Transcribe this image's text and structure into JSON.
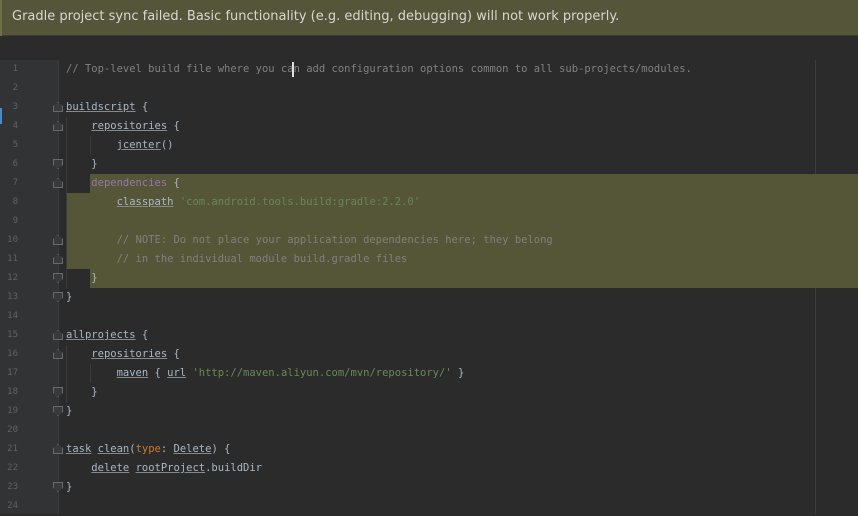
{
  "banner": {
    "message": "Gradle project sync failed. Basic functionality (e.g. editing, debugging) will not work properly."
  },
  "editor": {
    "lines": [
      {
        "n": "1",
        "segments": [
          {
            "t": "// Top-level build file where you can add configuration options common to all sub-projects/modules.",
            "c": "cmt"
          }
        ]
      },
      {
        "n": "2",
        "segments": []
      },
      {
        "n": "3",
        "segments": [
          {
            "t": "buildscript",
            "c": "meth"
          },
          {
            "t": " {",
            "c": "plain"
          }
        ]
      },
      {
        "n": "4",
        "segments": [
          {
            "t": "    ",
            "c": "plain"
          },
          {
            "t": "repositories",
            "c": "meth"
          },
          {
            "t": " {",
            "c": "plain"
          }
        ]
      },
      {
        "n": "5",
        "segments": [
          {
            "t": "        ",
            "c": "plain"
          },
          {
            "t": "jcenter",
            "c": "meth"
          },
          {
            "t": "()",
            "c": "plain"
          }
        ]
      },
      {
        "n": "6",
        "segments": [
          {
            "t": "    }",
            "c": "plain"
          }
        ]
      },
      {
        "n": "7",
        "segments": [
          {
            "t": "    ",
            "c": "plain"
          },
          {
            "t": "dependencies",
            "c": "tag"
          },
          {
            "t": " {",
            "c": "plain"
          }
        ]
      },
      {
        "n": "8",
        "segments": [
          {
            "t": "        ",
            "c": "plain"
          },
          {
            "t": "classpath",
            "c": "meth"
          },
          {
            "t": " ",
            "c": "plain"
          },
          {
            "t": "'com.android.tools.build:gradle:2.2.0'",
            "c": "str"
          }
        ]
      },
      {
        "n": "9",
        "segments": []
      },
      {
        "n": "10",
        "segments": [
          {
            "t": "        // NOTE: Do not place your application dependencies here; they belong",
            "c": "cmt"
          }
        ]
      },
      {
        "n": "11",
        "segments": [
          {
            "t": "        // in the individual module build.gradle files",
            "c": "cmt"
          }
        ]
      },
      {
        "n": "12",
        "segments": [
          {
            "t": "    }",
            "c": "plain"
          }
        ]
      },
      {
        "n": "13",
        "segments": [
          {
            "t": "}",
            "c": "plain"
          }
        ]
      },
      {
        "n": "14",
        "segments": []
      },
      {
        "n": "15",
        "segments": [
          {
            "t": "allprojects",
            "c": "meth"
          },
          {
            "t": " {",
            "c": "plain"
          }
        ]
      },
      {
        "n": "16",
        "segments": [
          {
            "t": "    ",
            "c": "plain"
          },
          {
            "t": "repositories",
            "c": "meth"
          },
          {
            "t": " {",
            "c": "plain"
          }
        ]
      },
      {
        "n": "17",
        "segments": [
          {
            "t": "        ",
            "c": "plain"
          },
          {
            "t": "maven",
            "c": "meth"
          },
          {
            "t": " { ",
            "c": "plain"
          },
          {
            "t": "url",
            "c": "meth"
          },
          {
            "t": " ",
            "c": "plain"
          },
          {
            "t": "'http://maven.aliyun.com/mvn/repository/'",
            "c": "str"
          },
          {
            "t": " }",
            "c": "plain"
          }
        ]
      },
      {
        "n": "18",
        "segments": [
          {
            "t": "    }",
            "c": "plain"
          }
        ]
      },
      {
        "n": "19",
        "segments": [
          {
            "t": "}",
            "c": "plain"
          }
        ]
      },
      {
        "n": "20",
        "segments": []
      },
      {
        "n": "21",
        "segments": [
          {
            "t": "task",
            "c": "meth"
          },
          {
            "t": " ",
            "c": "plain"
          },
          {
            "t": "clean",
            "c": "meth"
          },
          {
            "t": "(",
            "c": "plain"
          },
          {
            "t": "type",
            "c": "kw"
          },
          {
            "t": ": ",
            "c": "plain"
          },
          {
            "t": "Delete",
            "c": "meth"
          },
          {
            "t": ") {",
            "c": "plain"
          }
        ]
      },
      {
        "n": "22",
        "segments": [
          {
            "t": "    ",
            "c": "plain"
          },
          {
            "t": "delete",
            "c": "meth"
          },
          {
            "t": " ",
            "c": "plain"
          },
          {
            "t": "rootProject",
            "c": "meth"
          },
          {
            "t": ".buildDir",
            "c": "plain"
          }
        ]
      },
      {
        "n": "23",
        "segments": [
          {
            "t": "}",
            "c": "plain"
          }
        ]
      },
      {
        "n": "24",
        "segments": []
      }
    ]
  },
  "colors": {
    "banner_bg": "#55553a",
    "editor_bg": "#2b2b2b",
    "highlight": "#555537",
    "comment": "#808080",
    "string": "#6a8759",
    "keyword": "#cc7832"
  }
}
